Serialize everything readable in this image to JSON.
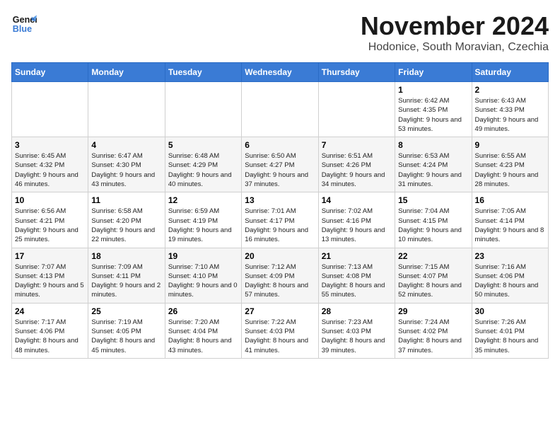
{
  "logo": {
    "line1": "General",
    "line2": "Blue"
  },
  "title": "November 2024",
  "subtitle": "Hodonice, South Moravian, Czechia",
  "days_of_week": [
    "Sunday",
    "Monday",
    "Tuesday",
    "Wednesday",
    "Thursday",
    "Friday",
    "Saturday"
  ],
  "weeks": [
    [
      {
        "day": "",
        "info": ""
      },
      {
        "day": "",
        "info": ""
      },
      {
        "day": "",
        "info": ""
      },
      {
        "day": "",
        "info": ""
      },
      {
        "day": "",
        "info": ""
      },
      {
        "day": "1",
        "info": "Sunrise: 6:42 AM\nSunset: 4:35 PM\nDaylight: 9 hours and 53 minutes."
      },
      {
        "day": "2",
        "info": "Sunrise: 6:43 AM\nSunset: 4:33 PM\nDaylight: 9 hours and 49 minutes."
      }
    ],
    [
      {
        "day": "3",
        "info": "Sunrise: 6:45 AM\nSunset: 4:32 PM\nDaylight: 9 hours and 46 minutes."
      },
      {
        "day": "4",
        "info": "Sunrise: 6:47 AM\nSunset: 4:30 PM\nDaylight: 9 hours and 43 minutes."
      },
      {
        "day": "5",
        "info": "Sunrise: 6:48 AM\nSunset: 4:29 PM\nDaylight: 9 hours and 40 minutes."
      },
      {
        "day": "6",
        "info": "Sunrise: 6:50 AM\nSunset: 4:27 PM\nDaylight: 9 hours and 37 minutes."
      },
      {
        "day": "7",
        "info": "Sunrise: 6:51 AM\nSunset: 4:26 PM\nDaylight: 9 hours and 34 minutes."
      },
      {
        "day": "8",
        "info": "Sunrise: 6:53 AM\nSunset: 4:24 PM\nDaylight: 9 hours and 31 minutes."
      },
      {
        "day": "9",
        "info": "Sunrise: 6:55 AM\nSunset: 4:23 PM\nDaylight: 9 hours and 28 minutes."
      }
    ],
    [
      {
        "day": "10",
        "info": "Sunrise: 6:56 AM\nSunset: 4:21 PM\nDaylight: 9 hours and 25 minutes."
      },
      {
        "day": "11",
        "info": "Sunrise: 6:58 AM\nSunset: 4:20 PM\nDaylight: 9 hours and 22 minutes."
      },
      {
        "day": "12",
        "info": "Sunrise: 6:59 AM\nSunset: 4:19 PM\nDaylight: 9 hours and 19 minutes."
      },
      {
        "day": "13",
        "info": "Sunrise: 7:01 AM\nSunset: 4:17 PM\nDaylight: 9 hours and 16 minutes."
      },
      {
        "day": "14",
        "info": "Sunrise: 7:02 AM\nSunset: 4:16 PM\nDaylight: 9 hours and 13 minutes."
      },
      {
        "day": "15",
        "info": "Sunrise: 7:04 AM\nSunset: 4:15 PM\nDaylight: 9 hours and 10 minutes."
      },
      {
        "day": "16",
        "info": "Sunrise: 7:05 AM\nSunset: 4:14 PM\nDaylight: 9 hours and 8 minutes."
      }
    ],
    [
      {
        "day": "17",
        "info": "Sunrise: 7:07 AM\nSunset: 4:13 PM\nDaylight: 9 hours and 5 minutes."
      },
      {
        "day": "18",
        "info": "Sunrise: 7:09 AM\nSunset: 4:11 PM\nDaylight: 9 hours and 2 minutes."
      },
      {
        "day": "19",
        "info": "Sunrise: 7:10 AM\nSunset: 4:10 PM\nDaylight: 9 hours and 0 minutes."
      },
      {
        "day": "20",
        "info": "Sunrise: 7:12 AM\nSunset: 4:09 PM\nDaylight: 8 hours and 57 minutes."
      },
      {
        "day": "21",
        "info": "Sunrise: 7:13 AM\nSunset: 4:08 PM\nDaylight: 8 hours and 55 minutes."
      },
      {
        "day": "22",
        "info": "Sunrise: 7:15 AM\nSunset: 4:07 PM\nDaylight: 8 hours and 52 minutes."
      },
      {
        "day": "23",
        "info": "Sunrise: 7:16 AM\nSunset: 4:06 PM\nDaylight: 8 hours and 50 minutes."
      }
    ],
    [
      {
        "day": "24",
        "info": "Sunrise: 7:17 AM\nSunset: 4:06 PM\nDaylight: 8 hours and 48 minutes."
      },
      {
        "day": "25",
        "info": "Sunrise: 7:19 AM\nSunset: 4:05 PM\nDaylight: 8 hours and 45 minutes."
      },
      {
        "day": "26",
        "info": "Sunrise: 7:20 AM\nSunset: 4:04 PM\nDaylight: 8 hours and 43 minutes."
      },
      {
        "day": "27",
        "info": "Sunrise: 7:22 AM\nSunset: 4:03 PM\nDaylight: 8 hours and 41 minutes."
      },
      {
        "day": "28",
        "info": "Sunrise: 7:23 AM\nSunset: 4:03 PM\nDaylight: 8 hours and 39 minutes."
      },
      {
        "day": "29",
        "info": "Sunrise: 7:24 AM\nSunset: 4:02 PM\nDaylight: 8 hours and 37 minutes."
      },
      {
        "day": "30",
        "info": "Sunrise: 7:26 AM\nSunset: 4:01 PM\nDaylight: 8 hours and 35 minutes."
      }
    ]
  ]
}
